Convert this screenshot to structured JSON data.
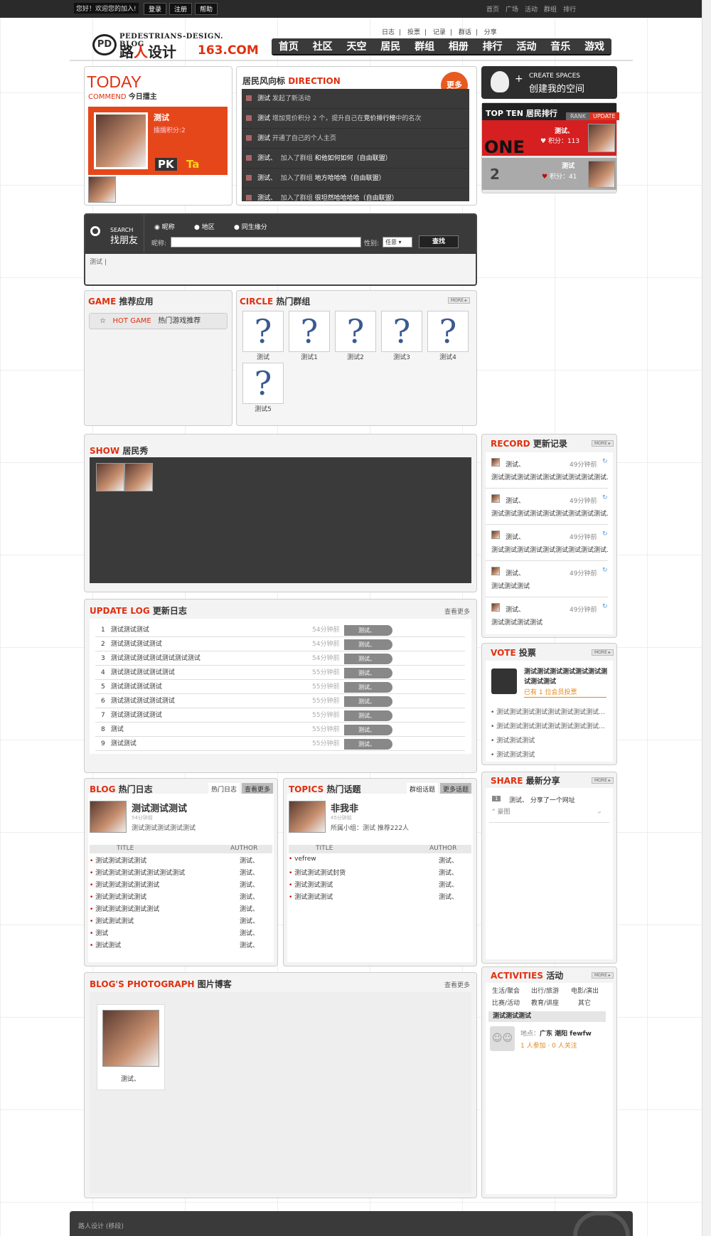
{
  "topbar": {
    "welcome": "您好！欢迎您的加入!",
    "login": "登录",
    "register": "注册",
    "help": "帮助",
    "links": [
      "首页",
      "广场",
      "活动",
      "群组",
      "排行"
    ]
  },
  "sublinks": [
    "日志",
    "投票",
    "记录",
    "群话",
    "分享"
  ],
  "sublinks_sep": "|",
  "logo": {
    "mark": "PD",
    "line1": "PEDESTRIANS-DESIGN. BLOG",
    "line2a": "路",
    "line2b": "人",
    "line2c": "设计",
    "line3": "163.COM"
  },
  "nav": [
    "首页",
    "社区",
    "天空",
    "居民",
    "群组",
    "相册",
    "排行",
    "活动",
    "音乐",
    "游戏"
  ],
  "today": {
    "big": "TODAY",
    "sub": "COMMEND",
    "sub_cn": "今日擂主",
    "name": "测试",
    "score": "擂擂积分:2",
    "pk": "PK",
    "ta": "Ta"
  },
  "direction": {
    "title_cn": "居民风向标",
    "title": "DIRECTION",
    "more": "更多",
    "feeds": [
      {
        "user": "测试",
        "text": "发起了新活动",
        "extra": ""
      },
      {
        "user": "测试",
        "text": "增加竞价积分 2 个，提升自己在",
        "extra": "竞价排行榜",
        "tail": "中的名次"
      },
      {
        "user": "测试",
        "text": "开通了自己的个人主页",
        "extra": ""
      },
      {
        "user": "测试、",
        "text": "加入了群组",
        "extra": "和他如何如何（自由联盟）"
      },
      {
        "user": "测试、",
        "text": "加入了群组",
        "extra": "地方哈哈哈（自由联盟）"
      },
      {
        "user": "测试、",
        "text": "加入了群组",
        "extra": "很坦然哈哈哈哈（自由联盟）"
      }
    ]
  },
  "create": {
    "line1": "CREATE SPACES",
    "line2": "创建我的空间",
    "plus": "+"
  },
  "topten": {
    "title": "TOP TEN",
    "title_cn": "居民排行",
    "rank": "RANK",
    "update": "UPDATE",
    "one": "ONE",
    "n1": "测试、",
    "s1": "积分：113",
    "two": "2",
    "n2": "测试",
    "s2": "积分：41"
  },
  "search": {
    "t1": "SEARCH",
    "t2": "找朋友",
    "opts": [
      "昵称",
      "地区",
      "同生缘分"
    ],
    "nick": "昵称:",
    "gender": "性别:",
    "gval": "任意",
    "btn": "查找",
    "result": "测试 |"
  },
  "game": {
    "title": "GAME",
    "title_cn": "推荐应用",
    "hot": "HOT GAME",
    "hot_cn": "热门游戏推荐",
    "star": "☆"
  },
  "circle": {
    "title": "CIRCLE",
    "title_cn": "热门群组",
    "more": "MORE ▸",
    "items": [
      "测试",
      "测试1",
      "测试2",
      "测试3",
      "测试4",
      "测试5"
    ]
  },
  "show": {
    "title": "SHOW",
    "title_cn": "居民秀"
  },
  "record": {
    "title": "RECORD",
    "title_cn": "更新记录",
    "more": "MORE ▸",
    "items": [
      {
        "u": "测试、",
        "t": "49分钟前",
        "c": "测试测试测试测试测试测试测试测试测试..."
      },
      {
        "u": "测试、",
        "t": "49分钟前",
        "c": "测试测试测试测试测试测试测试测试测试..."
      },
      {
        "u": "测试、",
        "t": "49分钟前",
        "c": "测试测试测试测试测试测试测试测试测试..."
      },
      {
        "u": "测试、",
        "t": "49分钟前",
        "c": "测试测试测试"
      },
      {
        "u": "测试、",
        "t": "49分钟前",
        "c": "测试测试测试测试"
      }
    ]
  },
  "updatelog": {
    "title": "UPDATE LOG",
    "title_cn": "更新日志",
    "more": "查看更多",
    "rows": [
      {
        "n": "1",
        "t": "测试测试测试",
        "time": "54分钟前",
        "u": "测试、"
      },
      {
        "n": "2",
        "t": "测试测试测试测试",
        "time": "54分钟前",
        "u": "测试、"
      },
      {
        "n": "3",
        "t": "测试测试测试测试测试测试测试",
        "time": "54分钟前",
        "u": "测试、"
      },
      {
        "n": "4",
        "t": "测试测试测试测试测试",
        "time": "55分钟前",
        "u": "测试、"
      },
      {
        "n": "5",
        "t": "测试测试测试测试",
        "time": "55分钟前",
        "u": "测试、"
      },
      {
        "n": "6",
        "t": "测试测试测试测试测试",
        "time": "55分钟前",
        "u": "测试、"
      },
      {
        "n": "7",
        "t": "测试测试测试测试",
        "time": "55分钟前",
        "u": "测试、"
      },
      {
        "n": "8",
        "t": "测试",
        "time": "55分钟前",
        "u": "测试、"
      },
      {
        "n": "9",
        "t": "测试测试",
        "time": "55分钟前",
        "u": "测试、"
      }
    ]
  },
  "vote": {
    "title": "VOTE",
    "title_cn": "投票",
    "more": "MORE ▸",
    "head": "测试测试测试测试测试测试测试测试测试",
    "count": "已有 1 位会员投票",
    "items": [
      "测试测试测试测试测试测试测试测试...",
      "测试测试测试测试测试测试测试测试...",
      "测试测试测试",
      "测试测试测试"
    ]
  },
  "share": {
    "title": "SHARE",
    "title_cn": "最新分享",
    "more": "MORE ▸",
    "num": "1",
    "text": "测试、  分享了一个网址",
    "quote": "“ 豪图",
    "qend": "”"
  },
  "blog": {
    "title": "BLOG",
    "title_cn": "热门日志",
    "tab": "热门日志",
    "more": "查看更多",
    "head": "测试测试测试",
    "time": "54分钟前",
    "desc": "测试测试测试测试测试",
    "col1": "TITLE",
    "col2": "AUTHOR",
    "rows": [
      [
        "测试测试测试测试",
        "测试、"
      ],
      [
        "测试测试测试测试测试测试测试",
        "测试、"
      ],
      [
        "测试测试测试测试测试",
        "测试、"
      ],
      [
        "测试测试测试测试",
        "测试、"
      ],
      [
        "测试测试测试测试测试",
        "测试、"
      ],
      [
        "测试测试测试",
        "测试、"
      ],
      [
        "测试",
        "测试、"
      ],
      [
        "测试测试",
        "测试、"
      ]
    ]
  },
  "topics": {
    "title": "TOPICS",
    "title_cn": "热门话题",
    "tab": "群组话题",
    "more": "更多话题",
    "head": "非我非",
    "time": "45分钟前",
    "desc": "所属小组：测试    推荐222人",
    "col1": "TITLE",
    "col2": "AUTHOR",
    "rows": [
      [
        "vefrew",
        "测试、"
      ],
      [
        "测试测试测试封货",
        "测试、"
      ],
      [
        "测试测试测试",
        "测试、"
      ],
      [
        "测试测试测试",
        "测试、"
      ]
    ]
  },
  "photo": {
    "title": "BLOG'S PHOTOGRAPH",
    "title_cn": "图片博客",
    "more": "查看更多",
    "cap": "测试、"
  },
  "activities": {
    "title": "ACTIVITIES",
    "title_cn": "活动",
    "more": "MORE ▸",
    "cats": [
      "生活/聚会",
      "出行/旅游",
      "电影/演出",
      "比赛/活动",
      "教育/讲座",
      "其它"
    ],
    "head": "测试测试测试",
    "loc_l": "地点：",
    "loc": "广东  潮阳  fewfw",
    "join": "1 人参加 · 0 人关注"
  },
  "footer": {
    "text": "路人设计 (移段)"
  }
}
